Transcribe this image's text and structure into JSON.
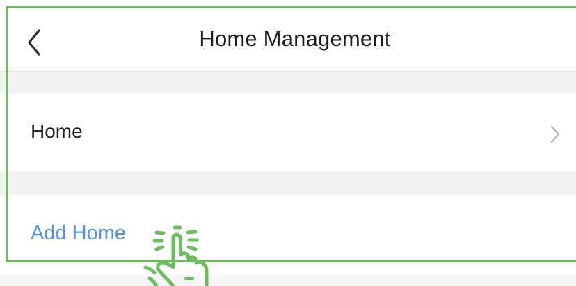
{
  "header": {
    "title": "Home Management",
    "back_icon": "chevron-left-icon"
  },
  "home_list": {
    "items": [
      {
        "label": "Home",
        "icon": "chevron-right-icon"
      }
    ]
  },
  "actions": {
    "add_home_label": "Add Home"
  },
  "overlay": {
    "tap_icon": "tap-hand-icon",
    "highlight_color": "#6abf5a"
  },
  "colors": {
    "accent": "#4f8ff7",
    "section_gap": "#f3f3f3",
    "text": "#1c1c1c"
  }
}
